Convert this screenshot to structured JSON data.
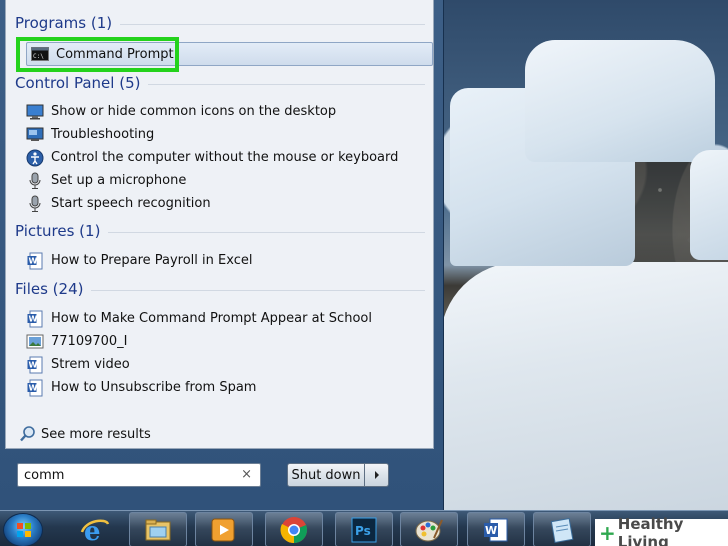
{
  "start_menu": {
    "groups": {
      "programs": {
        "header": "Programs (1)"
      },
      "control_panel": {
        "header": "Control Panel (5)"
      },
      "pictures": {
        "header": "Pictures (1)"
      },
      "files": {
        "header": "Files (24)"
      }
    },
    "programs": [
      {
        "label": "Command Prompt",
        "icon": "cmd-icon"
      }
    ],
    "control_panel": [
      {
        "label": "Show or hide common icons on the desktop",
        "icon": "desktop-icon"
      },
      {
        "label": "Troubleshooting",
        "icon": "troubleshoot-icon"
      },
      {
        "label": "Control the computer without the mouse or keyboard",
        "icon": "ease-of-access-icon"
      },
      {
        "label": "Set up a microphone",
        "icon": "microphone-icon"
      },
      {
        "label": "Start speech recognition",
        "icon": "microphone-icon"
      }
    ],
    "pictures": [
      {
        "label": "How to Prepare Payroll in Excel",
        "icon": "word-doc-icon"
      }
    ],
    "files": [
      {
        "label": "How to Make Command Prompt Appear at School",
        "icon": "word-doc-icon"
      },
      {
        "label": "77109700_I",
        "icon": "image-file-icon"
      },
      {
        "label": "Strem video",
        "icon": "word-doc-icon"
      },
      {
        "label": "How to Unsubscribe from Spam",
        "icon": "word-doc-icon"
      }
    ],
    "see_more": "See more results",
    "search": {
      "value": "comm",
      "clear": "×"
    },
    "shutdown_label": "Shut down"
  },
  "taskbar": {
    "items": [
      "start-orb",
      "internet-explorer-icon",
      "file-explorer-icon",
      "media-player-icon",
      "chrome-icon",
      "photoshop-icon",
      "paint-icon",
      "word-icon",
      "notepad-icon"
    ]
  },
  "watermark": {
    "text": "Healthy Living",
    "plus": "+"
  },
  "colors": {
    "highlight": "#24d21c",
    "group_header": "#1e3a8a"
  }
}
